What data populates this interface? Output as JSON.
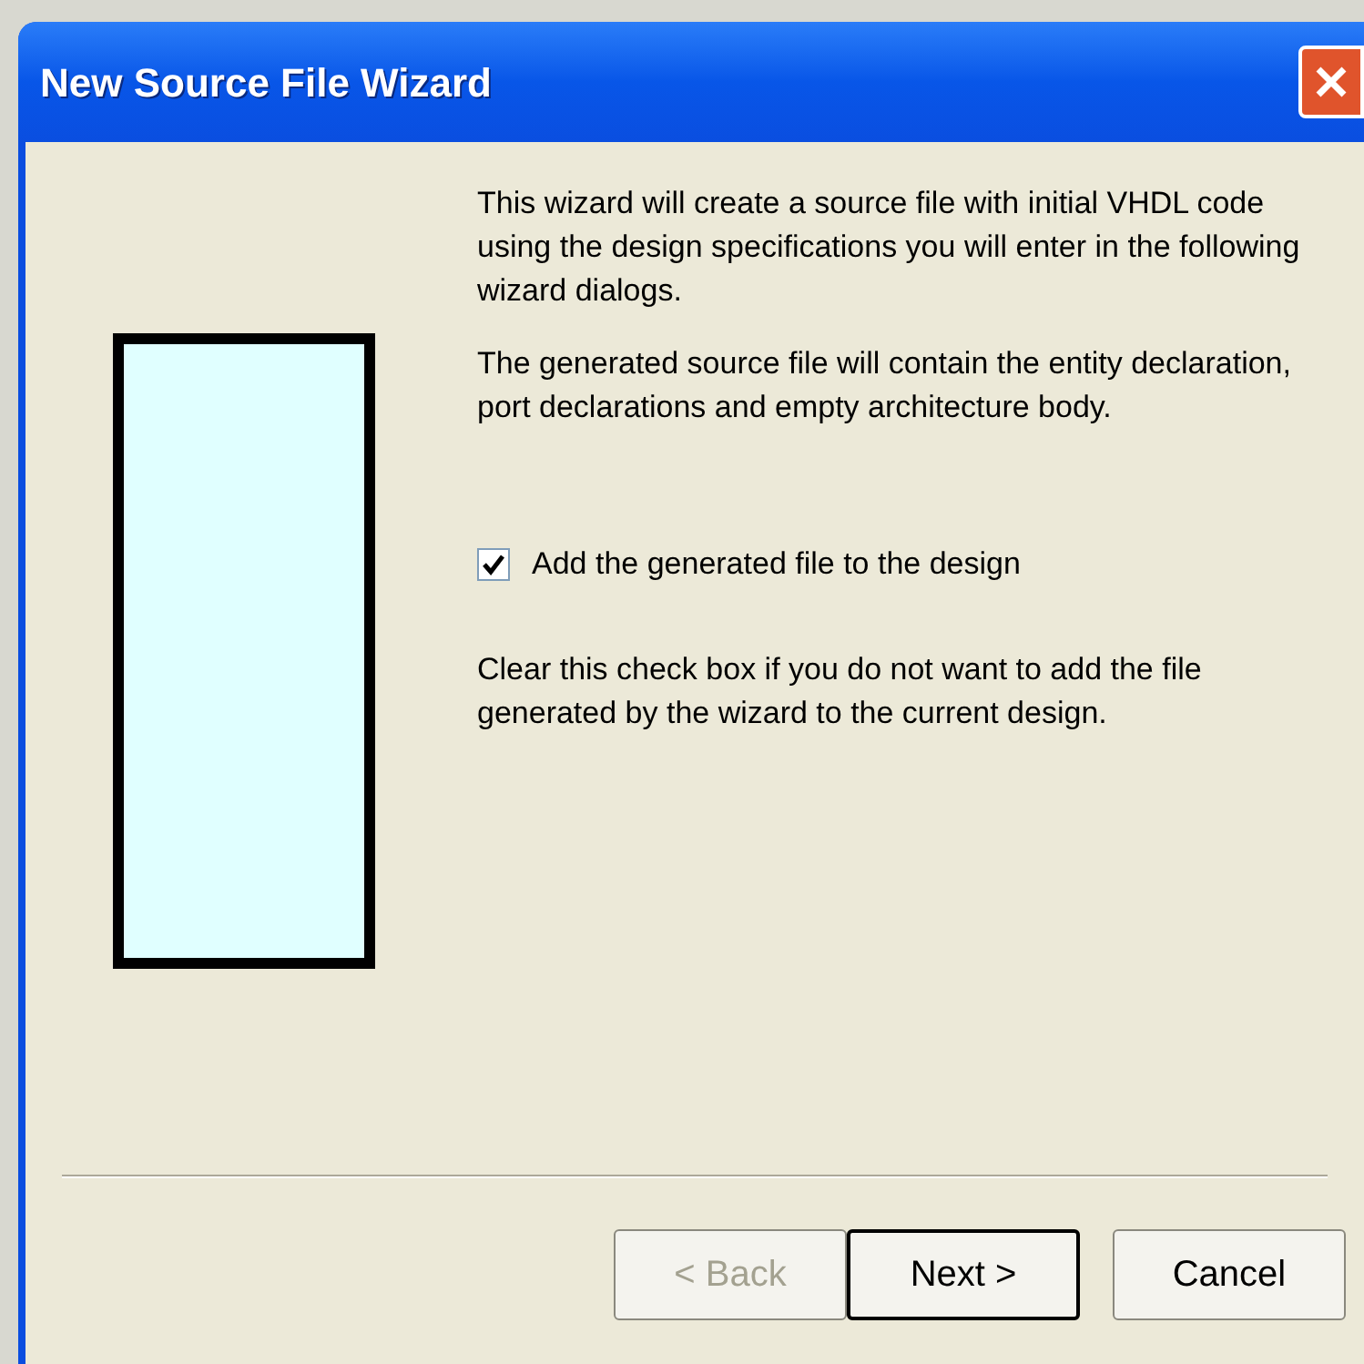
{
  "window": {
    "title": "New Source File Wizard"
  },
  "paragraphs": [
    "This wizard will create a source file with initial VHDL code using the design specifications you will enter in the following wizard dialogs.",
    "The generated source file will contain the entity declaration, port declarations and empty architecture body."
  ],
  "checkbox": {
    "label": "Add the generated file to the design",
    "checked": true
  },
  "note": "Clear this check box if you do not want to add the file generated by the wizard to the current design.",
  "buttons": [
    {
      "label": "< Back",
      "disabled": true,
      "default": false
    },
    {
      "label": "Next >",
      "disabled": false,
      "default": true
    },
    {
      "label": "Cancel",
      "disabled": false,
      "default": false
    }
  ]
}
